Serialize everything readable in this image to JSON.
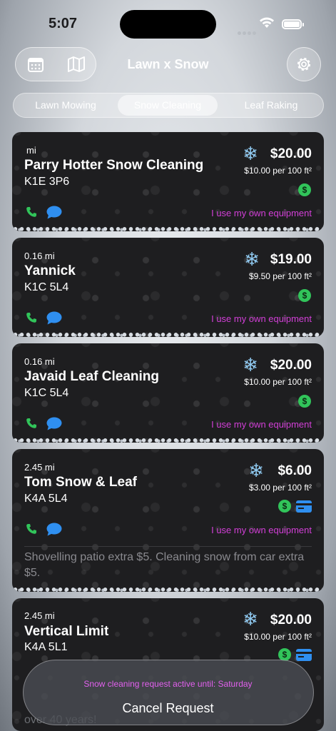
{
  "status_bar": {
    "time": "5:07"
  },
  "header": {
    "title": "Lawn x Snow",
    "left_buttons": [
      "calendar-icon",
      "map-icon"
    ],
    "right_button": "gear-icon"
  },
  "tabs": [
    {
      "label": "Lawn Mowing",
      "selected": false
    },
    {
      "label": "Snow Cleaning",
      "selected": true
    },
    {
      "label": "Leaf Raking",
      "selected": false
    }
  ],
  "providers": [
    {
      "distance": "mi",
      "name": "Parry Hotter Snow Cleaning",
      "postal": "K1E 3P6",
      "service_icon": "snowflake-icon",
      "price": "$20.00",
      "rate": "$10.00 per 100 ft²",
      "payment_methods": [
        "cash"
      ],
      "equipment": "I use my own equipment"
    },
    {
      "distance": "0.16 mi",
      "name": "Yannick",
      "postal": "K1C 5L4",
      "service_icon": "snowflake-icon",
      "price": "$19.00",
      "rate": "$9.50 per 100 ft²",
      "payment_methods": [
        "cash"
      ],
      "equipment": "I use my own equipment"
    },
    {
      "distance": "0.16 mi",
      "name": "Javaid Leaf Cleaning",
      "postal": "K1C 5L4",
      "service_icon": "snowflake-icon",
      "price": "$20.00",
      "rate": "$10.00 per 100 ft²",
      "payment_methods": [
        "cash"
      ],
      "equipment": "I use my own equipment"
    },
    {
      "distance": "2.45 mi",
      "name": "Tom Snow & Leaf",
      "postal": "K4A 5L4",
      "service_icon": "snowflake-icon",
      "price": "$6.00",
      "rate": "$3.00 per 100 ft²",
      "payment_methods": [
        "cash",
        "card"
      ],
      "equipment": "I use my own equipment",
      "notes": "Shovelling patio extra $5. Cleaning snow from car extra $5."
    },
    {
      "distance": "2.45 mi",
      "name": "Vertical Limit",
      "postal": "K4A 5L1",
      "service_icon": "snowflake-icon",
      "price": "$20.00",
      "rate": "$10.00 per 100 ft²",
      "payment_methods": [
        "cash",
        "card"
      ]
    }
  ],
  "request_panel": {
    "active_text": "Snow cleaning request active until: Saturday",
    "cancel_label": "Cancel Request"
  },
  "peek_text": "over 40 years!",
  "colors": {
    "card_bg": "#1e1e20",
    "equipment_text": "#d23fd7",
    "cash_green": "#31c45a",
    "card_blue": "#2f8ff0",
    "phone_green": "#31c45a",
    "chat_blue": "#2f8ff0"
  }
}
